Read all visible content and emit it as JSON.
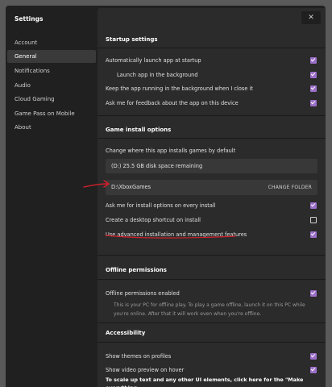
{
  "app": {
    "title": "Settings",
    "close_glyph": "✕"
  },
  "sidebar": {
    "items": [
      {
        "label": "Account"
      },
      {
        "label": "General"
      },
      {
        "label": "Notifications"
      },
      {
        "label": "Audio"
      },
      {
        "label": "Cloud Gaming"
      },
      {
        "label": "Game Pass on Mobile"
      },
      {
        "label": "About"
      }
    ],
    "active": "General"
  },
  "startup": {
    "title": "Startup settings",
    "items": [
      {
        "label": "Automatically launch app at startup",
        "checked": true
      },
      {
        "label": "Launch app in the background",
        "checked": true
      },
      {
        "label": "Keep the app running in the background when I close it",
        "checked": true
      },
      {
        "label": "Ask me for feedback about the app on this device",
        "checked": true
      }
    ]
  },
  "install": {
    "title": "Game install options",
    "drive_label": "Change where this app installs games by default",
    "drive_value": "(D:) 25.5 GB disk space remaining",
    "folder_path": "D:\\XboxGames",
    "change_folder": "CHANGE FOLDER",
    "items": [
      {
        "label": "Ask me for install options on every install",
        "checked": true
      },
      {
        "label": "Create a desktop shortcut on install",
        "checked": false
      },
      {
        "label": "Use advanced installation and management features",
        "checked": true
      }
    ]
  },
  "offline": {
    "title": "Offline permissions",
    "enabled_label": "Offline permissions enabled",
    "enabled_checked": true,
    "description": "This is your PC for offline play. To play a game offline, launch it on this PC while you're online. After that it will work even when you're offline."
  },
  "accessibility": {
    "title": "Accessibility",
    "items": [
      {
        "label": "Show themes on profiles",
        "checked": true
      },
      {
        "label": "Show video preview on hover",
        "checked": true
      }
    ],
    "footer": "To scale up text and any other UI elements, click here for the \"Make everything"
  },
  "colors": {
    "accent": "#9b6fc8",
    "annotation": "#d0202a"
  }
}
